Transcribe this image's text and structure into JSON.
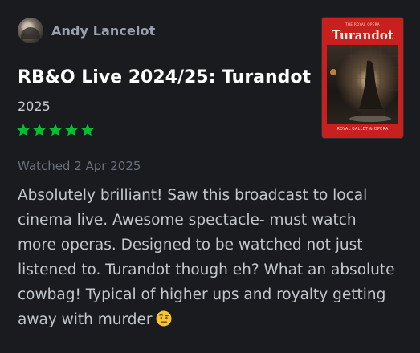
{
  "author": {
    "name": "Andy Lancelot"
  },
  "film": {
    "title": "RB&O Live 2024/25: Turandot",
    "year": "2025"
  },
  "rating": {
    "stars": 5,
    "max": 5,
    "color": "#00c030"
  },
  "watched": "Watched 2 Apr 2025",
  "review": "Absolutely brilliant! Saw this broadcast to local cinema live. Awesome spectacle- must watch more operas. Designed to be watched not just listened to. Turandot though eh? What an absolute cowbag! Typical of higher ups and royalty getting away with murder",
  "emoji": "raised-eyebrow-face-icon",
  "poster": {
    "top_text": "THE ROYAL OPERA",
    "title": "Turandot",
    "footer": "ROYAL BALLET & OPERA"
  }
}
